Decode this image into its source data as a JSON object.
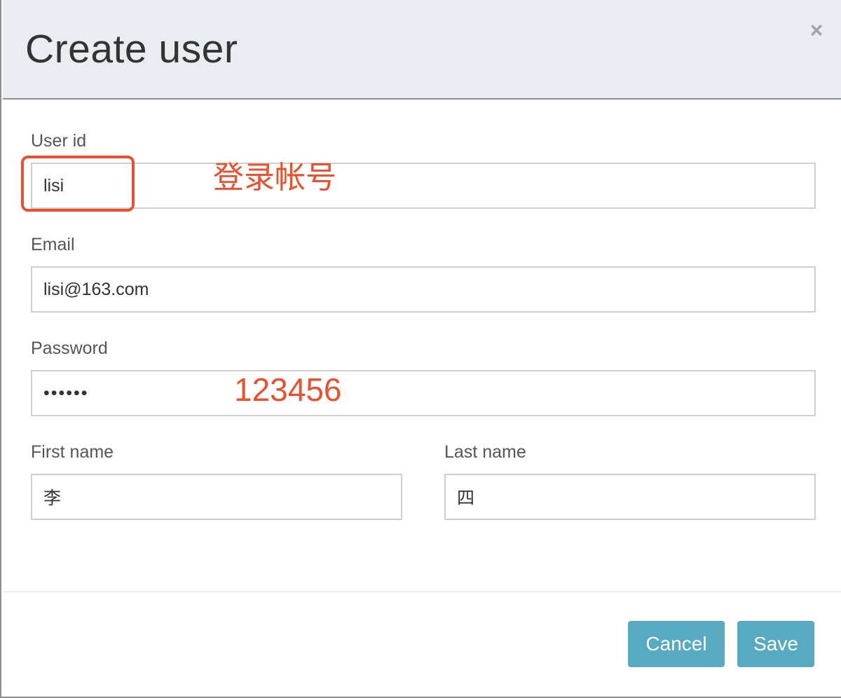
{
  "dialog": {
    "title": "Create user",
    "close_glyph": "×"
  },
  "form": {
    "user_id": {
      "label": "User id",
      "value": "lisi"
    },
    "email": {
      "label": "Email",
      "value": "lisi@163.com"
    },
    "password": {
      "label": "Password",
      "value": "123456",
      "masked_display": "••••••"
    },
    "first_name": {
      "label": "First name",
      "value": "李"
    },
    "last_name": {
      "label": "Last name",
      "value": "四"
    }
  },
  "annotations": {
    "user_id_note": "登录帐号",
    "password_note": "123456",
    "color": "#e85230"
  },
  "footer": {
    "cancel_label": "Cancel",
    "save_label": "Save",
    "button_color": "#58aac2"
  },
  "icons": {
    "close": "close-icon"
  }
}
